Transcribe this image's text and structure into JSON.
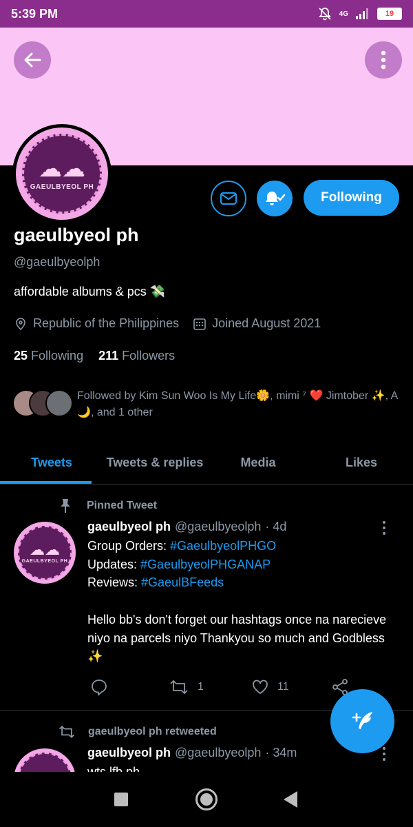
{
  "status_bar": {
    "time": "5:39 PM",
    "network": "4G",
    "battery": "19",
    "bg_color": "#8a2d8c"
  },
  "banner": {
    "color": "#fbc6f6"
  },
  "profile": {
    "avatar_text": "GAEULBYEOL PH",
    "name": "gaeulbyeol ph",
    "handle": "@gaeulbyeolph",
    "bio": "affordable albums & pcs 💸",
    "location": "Republic of the Philippines",
    "joined": "Joined August 2021",
    "following_count": "25",
    "following_label": "Following",
    "followers_count": "211",
    "followers_label": "Followers",
    "followed_by": "Followed by Kim Sun Woo Is My Life🌼, mimi ⁷ ❤️ Jimtober ✨, A🌙, and 1 other"
  },
  "actions": {
    "follow_label": "Following",
    "accent": "#1d9bf0"
  },
  "tabs": [
    {
      "label": "Tweets",
      "active": true
    },
    {
      "label": "Tweets & replies",
      "active": false
    },
    {
      "label": "Media",
      "active": false
    },
    {
      "label": "Likes",
      "active": false
    }
  ],
  "pinned_tweet": {
    "pin_label": "Pinned Tweet",
    "name": "gaeulbyeol ph",
    "handle": "@gaeulbyeolph",
    "time": "· 4d",
    "line1_prefix": "Group Orders: ",
    "line1_tag": "#GaeulbyeolPHGO",
    "line2_prefix": "Updates: ",
    "line2_tag": "#GaeulbyeolPHGANAP",
    "line3_prefix": "Reviews: ",
    "line3_tag": "#GaeulBFeeds",
    "message": "Hello bb's don't forget our hashtags once na narecieve niyo na parcels niyo Thankyou so much and Godbless ✨",
    "retweets": "1",
    "likes": "11"
  },
  "retweet_item": {
    "rt_label": "gaeulbyeol ph retweeted",
    "name": "gaeulbyeol ph",
    "handle": "@gaeulbyeolph",
    "time": "· 34m",
    "text": "wts lfb ph"
  }
}
